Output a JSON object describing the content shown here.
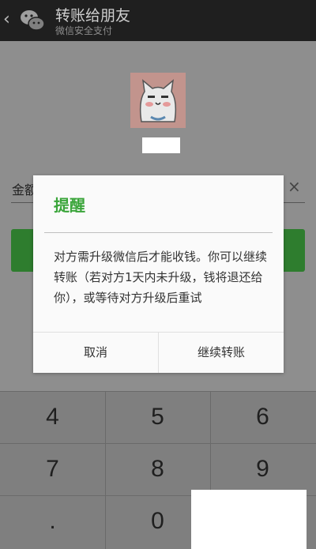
{
  "header": {
    "back_glyph": "‹",
    "title": "转账给朋友",
    "subtitle": "微信安全支付"
  },
  "transfer": {
    "amount_label": "金额",
    "clear_glyph": "×"
  },
  "dialog": {
    "title": "提醒",
    "message": "对方需升级微信后才能收钱。你可以继续转账（若对方1天内未升级，钱将退还给你），或等待对方升级后重试",
    "cancel_label": "取消",
    "continue_label": "继续转账"
  },
  "keypad": {
    "keys": [
      "4",
      "5",
      "6",
      "7",
      "8",
      "9",
      ".",
      "0"
    ]
  },
  "colors": {
    "accent_green": "#3aa53a",
    "topbar": "#1f1f1f",
    "overlay_gray": "#8e8e8e"
  }
}
